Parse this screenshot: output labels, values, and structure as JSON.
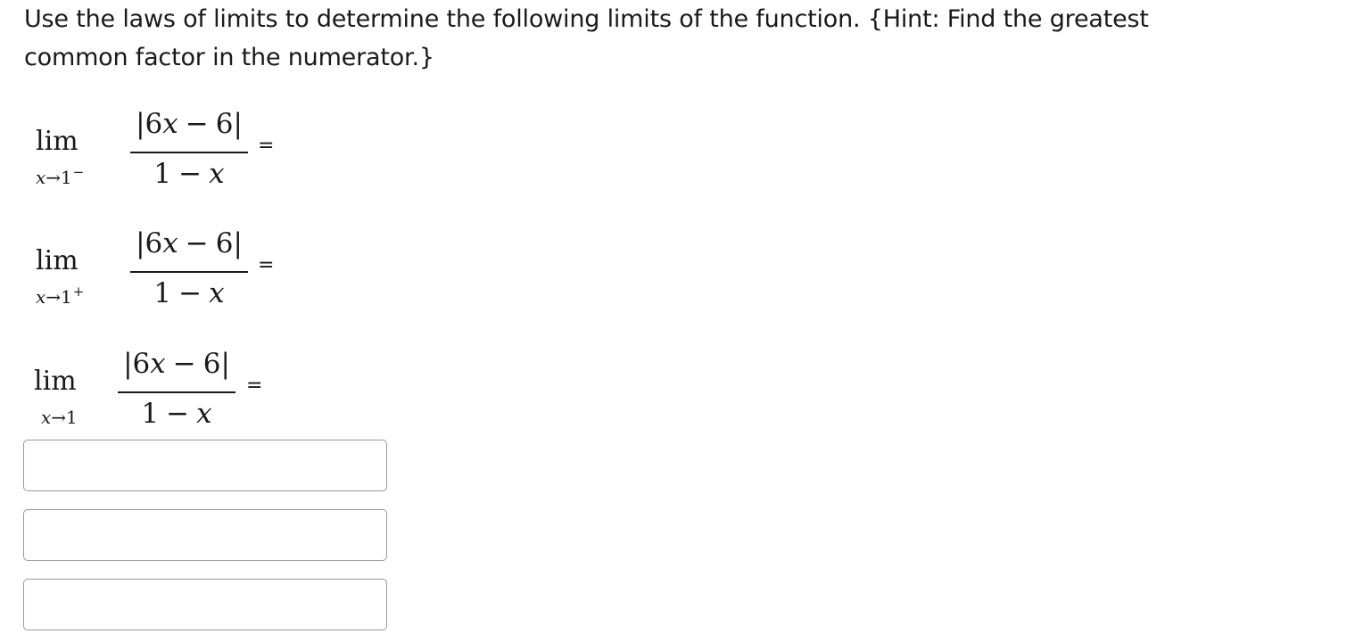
{
  "prompt": {
    "line1": "Use the laws of limits to determine the following limits of the function. {Hint: Find the greatest",
    "line2": "common factor in the numerator.}"
  },
  "limits": [
    {
      "lim": "lim",
      "sub_var": "x",
      "sub_arrow": "→",
      "sub_value": "1",
      "sub_side": "−",
      "numerator": {
        "open": "|6",
        "var": "x",
        "op": "−",
        "close": "6|"
      },
      "denominator": {
        "const": "1",
        "op": "−",
        "var": "x"
      },
      "equals": "="
    },
    {
      "lim": "lim",
      "sub_var": "x",
      "sub_arrow": "→",
      "sub_value": "1",
      "sub_side": "+",
      "numerator": {
        "open": "|6",
        "var": "x",
        "op": "−",
        "close": "6|"
      },
      "denominator": {
        "const": "1",
        "op": "−",
        "var": "x"
      },
      "equals": "="
    },
    {
      "lim": "lim",
      "sub_var": "x",
      "sub_arrow": "→",
      "sub_value": "1",
      "sub_side": "",
      "numerator": {
        "open": "|6",
        "var": "x",
        "op": "−",
        "close": "6|"
      },
      "denominator": {
        "const": "1",
        "op": "−",
        "var": "x"
      },
      "equals": "="
    }
  ],
  "answers": [
    {
      "value": "",
      "placeholder": ""
    },
    {
      "value": "",
      "placeholder": ""
    },
    {
      "value": "",
      "placeholder": ""
    }
  ]
}
